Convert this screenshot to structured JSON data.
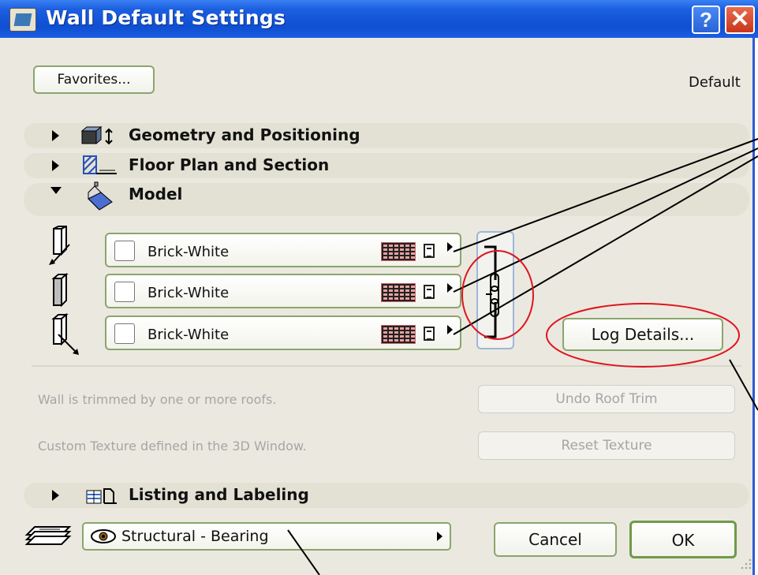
{
  "window": {
    "title": "Wall Default Settings",
    "help_glyph": "?",
    "close_glyph": "✕"
  },
  "header": {
    "favorites_label": "Favorites...",
    "default_label": "Default"
  },
  "sections": [
    {
      "label": "Geometry and Positioning",
      "expanded": false,
      "icon": "geometry-icon"
    },
    {
      "label": "Floor Plan and Section",
      "expanded": false,
      "icon": "floor-plan-icon"
    },
    {
      "label": "Model",
      "expanded": true,
      "icon": "model-icon"
    },
    {
      "label": "Listing and Labeling",
      "expanded": false,
      "icon": "listing-icon"
    }
  ],
  "model": {
    "materials": [
      {
        "surface": "outside-face",
        "name": "Brick-White"
      },
      {
        "surface": "edge",
        "name": "Brick-White"
      },
      {
        "surface": "inside-face",
        "name": "Brick-White"
      }
    ],
    "log_details_label": "Log Details...",
    "roof_trim_note": "Wall is trimmed by one or more roofs.",
    "undo_roof_trim_label": "Undo Roof Trim",
    "texture_note": "Custom Texture defined in the 3D Window.",
    "reset_texture_label": "Reset Texture"
  },
  "footer": {
    "layer_value": "Structural - Bearing",
    "cancel_label": "Cancel",
    "ok_label": "OK"
  },
  "colors": {
    "title_bar": "#1b5fe0",
    "dialog_bg": "#ebe9df",
    "button_border": "#8aa56e",
    "annotation_red": "#e0141e"
  }
}
